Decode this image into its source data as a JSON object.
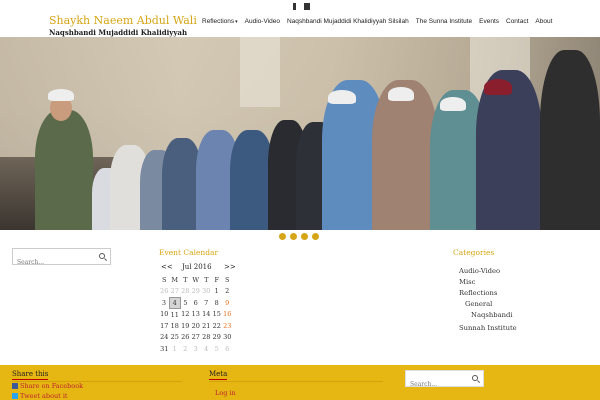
{
  "header": {
    "site_title": "Shaykh Naeem Abdul Wali",
    "tagline": "Naqshbandi Mujaddidi Khalidiyyah",
    "social": [
      "facebook-icon",
      "youtube-icon"
    ],
    "nav": [
      {
        "label": "Reflections",
        "has_dropdown": true
      },
      {
        "label": "Audio-Video"
      },
      {
        "label": "Naqshbandi Mujaddidi Khalidiyyah Silsilah"
      },
      {
        "label": "The Sunna Institute"
      },
      {
        "label": "Events"
      },
      {
        "label": "Contact"
      },
      {
        "label": "About"
      }
    ]
  },
  "slider": {
    "dots": 4,
    "active_dot": 0
  },
  "search": {
    "placeholder": "Search..."
  },
  "calendar": {
    "title": "Event Calendar",
    "prev": "<<",
    "month": "Jul 2016",
    "next": ">>",
    "days": [
      "S",
      "M",
      "T",
      "W",
      "T",
      "F",
      "S"
    ],
    "weeks": [
      [
        "26",
        "27",
        "28",
        "29",
        "30",
        "1",
        "2"
      ],
      [
        "3",
        "4",
        "5",
        "6",
        "7",
        "8",
        "9"
      ],
      [
        "10",
        "11",
        "12",
        "13",
        "14",
        "15",
        "16"
      ],
      [
        "17",
        "18",
        "19",
        "20",
        "21",
        "22",
        "23"
      ],
      [
        "24",
        "25",
        "26",
        "27",
        "28",
        "29",
        "30"
      ],
      [
        "31",
        "1",
        "2",
        "3",
        "4",
        "5",
        "6"
      ]
    ]
  },
  "categories": {
    "title": "Categories",
    "items": [
      {
        "label": "Audio-Video",
        "level": 0
      },
      {
        "label": "Misc",
        "level": 0
      },
      {
        "label": "Reflections",
        "level": 0
      },
      {
        "label": "General",
        "level": 1
      },
      {
        "label": "Naqshbandi",
        "level": 2
      },
      {
        "label": "Sunnah Institute",
        "level": 0
      }
    ]
  },
  "footer": {
    "share_title": "Share this",
    "share_facebook": "Share on Facebook",
    "share_twitter": "Tweet about it",
    "meta_title": "Meta",
    "meta_login": "Log in",
    "search_placeholder": "Search..."
  },
  "colors": {
    "accent": "#d6a515",
    "footer_bg": "#e6b712",
    "sunday": "#e8711d",
    "link": "#b23333"
  }
}
